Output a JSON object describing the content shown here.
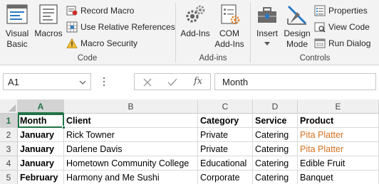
{
  "ribbon": {
    "code_group": {
      "label": "Code",
      "visual_basic": [
        "Visual",
        "Basic"
      ],
      "macros": "Macros",
      "record_macro": "Record Macro",
      "use_relative_references": "Use Relative References",
      "macro_security": "Macro Security"
    },
    "addins_group": {
      "label": "Add-ins",
      "add_ins": "Add-Ins",
      "com_add_ins": [
        "COM",
        "Add-Ins"
      ]
    },
    "controls_group": {
      "label": "Controls",
      "insert": "Insert",
      "design_mode": [
        "Design",
        "Mode"
      ],
      "properties": "Properties",
      "view_code": "View Code",
      "run_dialog": "Run Dialog"
    }
  },
  "formula_bar": {
    "name_box": "A1",
    "fx_label": "fx",
    "content": "Month"
  },
  "colors": {
    "accent_green": "#217346",
    "link_orange": "#d4731f"
  },
  "grid": {
    "columns": [
      "A",
      "B",
      "C",
      "D",
      "E"
    ],
    "rows": [
      {
        "num": "1",
        "cells": [
          "Month",
          "Client",
          "Category",
          "Service",
          "Product"
        ]
      },
      {
        "num": "2",
        "cells": [
          "January",
          "Rick Towner",
          "Private",
          "Catering",
          "Pita Platter"
        ]
      },
      {
        "num": "3",
        "cells": [
          "January",
          "Darlene Davis",
          "Private",
          "Catering",
          "Pita Platter"
        ]
      },
      {
        "num": "4",
        "cells": [
          "January",
          "Hometown Community College",
          "Educational",
          "Catering",
          "Edible Fruit"
        ]
      },
      {
        "num": "5",
        "cells": [
          "February",
          "Harmony and Me Sushi",
          "Corporate",
          "Catering",
          "Banquet"
        ]
      }
    ]
  }
}
